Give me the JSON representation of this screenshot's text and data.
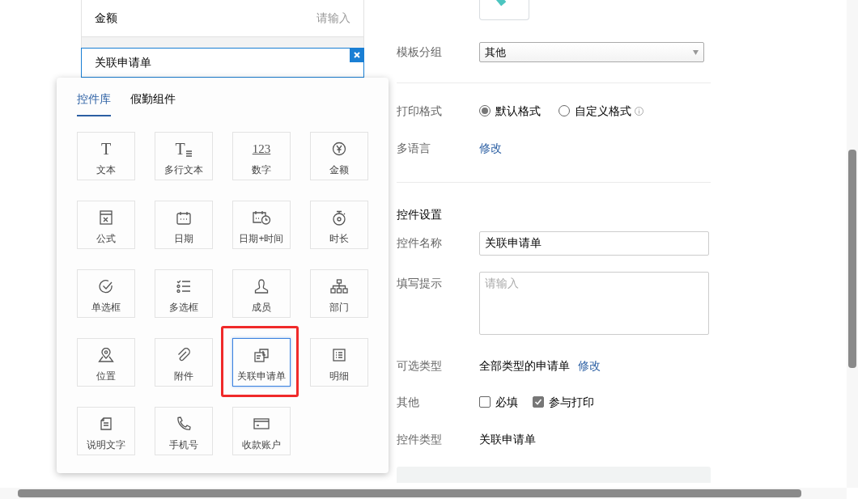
{
  "canvas_fields": [
    {
      "label": "金额",
      "placeholder": "请输入",
      "selected": false
    },
    {
      "label": "关联申请单",
      "selected": true
    }
  ],
  "palette": {
    "tabs": [
      {
        "label": "控件库",
        "selected": true
      },
      {
        "label": "假勤组件",
        "selected": false
      }
    ],
    "items": [
      {
        "label": "文本",
        "kind": "text",
        "glyph": "T",
        "selected": false,
        "highlighted": false
      },
      {
        "label": "多行文本",
        "kind": "multiline",
        "glyph": "T",
        "selected": false,
        "highlighted": false
      },
      {
        "label": "数字",
        "kind": "number",
        "glyph": "123",
        "selected": false,
        "highlighted": false
      },
      {
        "label": "金额",
        "kind": "money",
        "selected": false,
        "highlighted": false
      },
      {
        "label": "公式",
        "kind": "formula",
        "selected": false,
        "highlighted": false
      },
      {
        "label": "日期",
        "kind": "date",
        "selected": false,
        "highlighted": false
      },
      {
        "label": "日期+时间",
        "kind": "datetime",
        "selected": false,
        "highlighted": false
      },
      {
        "label": "时长",
        "kind": "duration",
        "selected": false,
        "highlighted": false
      },
      {
        "label": "单选框",
        "kind": "radio",
        "selected": false,
        "highlighted": false
      },
      {
        "label": "多选框",
        "kind": "checklist",
        "selected": false,
        "highlighted": false
      },
      {
        "label": "成员",
        "kind": "member",
        "selected": false,
        "highlighted": false
      },
      {
        "label": "部门",
        "kind": "org",
        "selected": false,
        "highlighted": false
      },
      {
        "label": "位置",
        "kind": "location",
        "selected": false,
        "highlighted": false
      },
      {
        "label": "附件",
        "kind": "attachment",
        "selected": false,
        "highlighted": false
      },
      {
        "label": "关联申请单",
        "kind": "linked",
        "selected": true,
        "highlighted": true
      },
      {
        "label": "明细",
        "kind": "detail",
        "selected": false,
        "highlighted": false
      },
      {
        "label": "说明文字",
        "kind": "note",
        "selected": false,
        "highlighted": false
      },
      {
        "label": "手机号",
        "kind": "phone",
        "selected": false,
        "highlighted": false
      },
      {
        "label": "收款账户",
        "kind": "account",
        "selected": false,
        "highlighted": false
      }
    ]
  },
  "settings": {
    "template_group": {
      "label": "模板分组",
      "value": "其他"
    },
    "print_format": {
      "label": "打印格式",
      "options": [
        {
          "label": "默认格式",
          "selected": true
        },
        {
          "label": "自定义格式",
          "selected": false
        }
      ]
    },
    "multilingual": {
      "label": "多语言",
      "link": "修改"
    },
    "section_title": "控件设置",
    "control_name": {
      "label": "控件名称",
      "value": "关联申请单"
    },
    "hint": {
      "label": "填写提示",
      "placeholder": "请输入"
    },
    "selectable_type": {
      "label": "可选类型",
      "value": "全部类型的申请单",
      "link": "修改"
    },
    "other": {
      "label": "其他",
      "options": [
        {
          "label": "必填",
          "checked": false
        },
        {
          "label": "参与打印",
          "checked": true
        }
      ]
    },
    "control_type": {
      "label": "控件类型",
      "value": "关联申请单"
    }
  }
}
